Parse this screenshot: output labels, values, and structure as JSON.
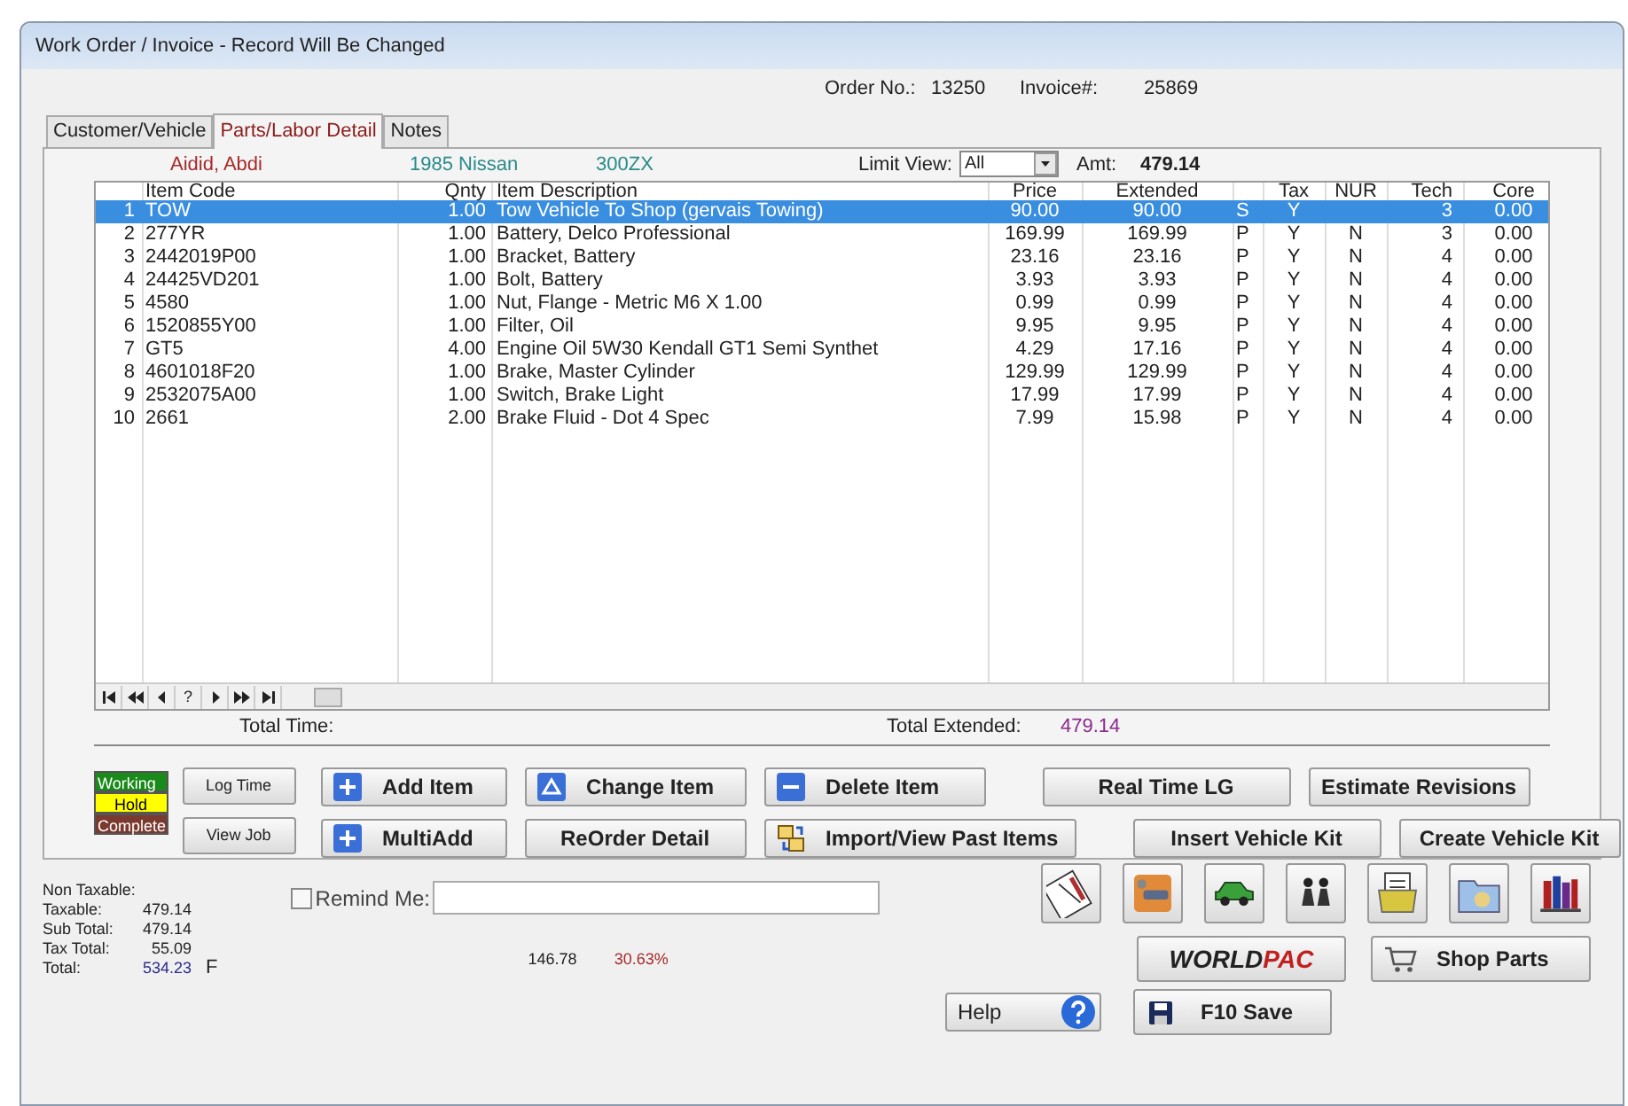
{
  "window": {
    "title": "Work Order / Invoice - Record Will Be Changed"
  },
  "header": {
    "order_label": "Order No.:",
    "order_no": "13250",
    "invoice_label": "Invoice#:",
    "invoice_no": "25869"
  },
  "tabs": [
    {
      "label": "Customer/Vehicle",
      "selected": false
    },
    {
      "label": "Parts/Labor Detail",
      "selected": true
    },
    {
      "label": "Notes",
      "selected": false
    }
  ],
  "customer": {
    "name": "Aidid, Abdi",
    "vehicle": "1985 Nissan",
    "model": "300ZX",
    "limit_label": "Limit View:",
    "limit_value": "All",
    "amt_label": "Amt:",
    "amt": "479.14"
  },
  "table": {
    "columns": [
      "",
      "Item Code",
      "Qnty",
      "Item Description",
      "Price",
      "Extended",
      "",
      "Tax",
      "NUR",
      "Tech",
      "Core"
    ],
    "rows": [
      {
        "selected": true,
        "cells": [
          "1",
          "TOW",
          "1.00",
          "Tow Vehicle To Shop (gervais Towing)",
          "90.00",
          "90.00",
          "S",
          "Y",
          "",
          "3",
          "0.00"
        ]
      },
      {
        "selected": false,
        "cells": [
          "2",
          "277YR",
          "1.00",
          "Battery, Delco Professional",
          "169.99",
          "169.99",
          "P",
          "Y",
          "N",
          "3",
          "0.00"
        ]
      },
      {
        "selected": false,
        "cells": [
          "3",
          "2442019P00",
          "1.00",
          "Bracket, Battery",
          "23.16",
          "23.16",
          "P",
          "Y",
          "N",
          "4",
          "0.00"
        ]
      },
      {
        "selected": false,
        "cells": [
          "4",
          "24425VD201",
          "1.00",
          "Bolt, Battery",
          "3.93",
          "3.93",
          "P",
          "Y",
          "N",
          "4",
          "0.00"
        ]
      },
      {
        "selected": false,
        "cells": [
          "5",
          "4580",
          "1.00",
          "Nut, Flange - Metric M6 X 1.00",
          "0.99",
          "0.99",
          "P",
          "Y",
          "N",
          "4",
          "0.00"
        ]
      },
      {
        "selected": false,
        "cells": [
          "6",
          "1520855Y00",
          "1.00",
          "Filter, Oil",
          "9.95",
          "9.95",
          "P",
          "Y",
          "N",
          "4",
          "0.00"
        ]
      },
      {
        "selected": false,
        "cells": [
          "7",
          "GT5",
          "4.00",
          "Engine Oil 5W30 Kendall GT1 Semi Synthet",
          "4.29",
          "17.16",
          "P",
          "Y",
          "N",
          "4",
          "0.00"
        ]
      },
      {
        "selected": false,
        "cells": [
          "8",
          "4601018F20",
          "1.00",
          "Brake, Master Cylinder",
          "129.99",
          "129.99",
          "P",
          "Y",
          "N",
          "4",
          "0.00"
        ]
      },
      {
        "selected": false,
        "cells": [
          "9",
          "2532075A00",
          "1.00",
          "Switch, Brake Light",
          "17.99",
          "17.99",
          "P",
          "Y",
          "N",
          "4",
          "0.00"
        ]
      },
      {
        "selected": false,
        "cells": [
          "10",
          "2661",
          "2.00",
          "Brake Fluid - Dot 4 Spec",
          "7.99",
          "15.98",
          "P",
          "Y",
          "N",
          "4",
          "0.00"
        ]
      }
    ]
  },
  "navigator": {
    "help": "?"
  },
  "totals": {
    "time_label": "Total Time:",
    "extended_label": "Total Extended:",
    "extended": "479.14"
  },
  "status_legend": [
    {
      "label": "Working",
      "color": "#1a8a1a"
    },
    {
      "label": "Hold",
      "color": "#ffff00"
    },
    {
      "label": "Complete",
      "color": "#7a3a30"
    }
  ],
  "small_buttons": [
    "Log Time",
    "View Job"
  ],
  "action_rows": [
    [
      {
        "label": "Add Item",
        "kind": "plus"
      },
      {
        "label": "Change Item",
        "kind": "triangle"
      },
      {
        "label": "Delete Item",
        "kind": "minus"
      },
      {
        "label": "Real Time LG",
        "kind": "plain"
      },
      {
        "label": "Estimate Revisions",
        "kind": "plain"
      }
    ],
    [
      {
        "label": "MultiAdd",
        "kind": "plus"
      },
      {
        "label": "ReOrder Detail",
        "kind": "plain"
      },
      {
        "label": "Import/View Past Items",
        "kind": "import"
      },
      {
        "label": "Insert Vehicle Kit",
        "kind": "plain"
      },
      {
        "label": "Create Vehicle Kit",
        "kind": "plain"
      }
    ]
  ],
  "summary": [
    {
      "label": "Non Taxable:"
    },
    {
      "label": "Taxable:",
      "value": "479.14"
    },
    {
      "label": "Sub Total:",
      "value": "479.14"
    },
    {
      "label": "Tax Total:",
      "value": "55.09"
    },
    {
      "label": "Total:",
      "value": "534.23"
    }
  ],
  "total_flag": "F",
  "remind": {
    "label": "Remind Me:",
    "checked": false
  },
  "profit": {
    "amount": "146.78",
    "percent": "30.63%"
  },
  "worldpac": {
    "part1": "WORLD",
    "part2": "PAC"
  },
  "shop_parts": "Shop Parts",
  "help": "Help",
  "save": "F10 Save"
}
